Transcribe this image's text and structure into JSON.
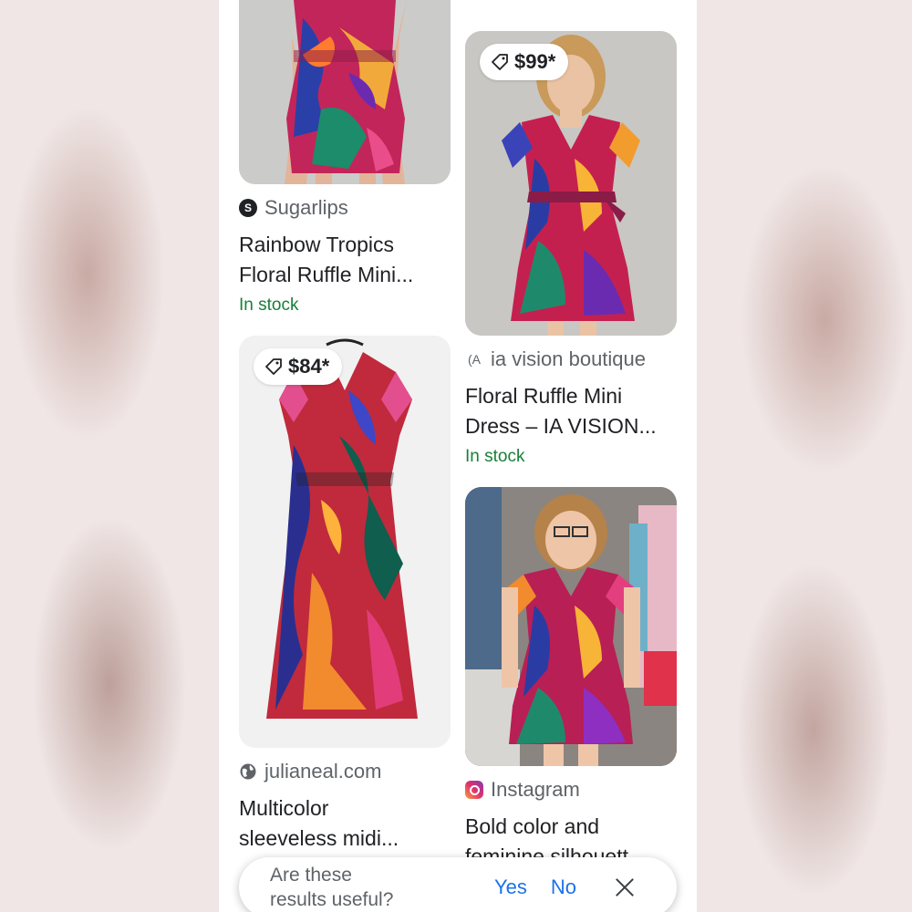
{
  "results": {
    "left": [
      {
        "source": "Sugarlips",
        "source_icon": "sugarlips-logo-icon",
        "title_lines": [
          "Rainbow Tropics",
          "Floral Ruffle Mini..."
        ],
        "stock": "In stock"
      },
      {
        "price": "$84*",
        "source": "julianeal.com",
        "source_icon": "globe-icon",
        "title_lines": [
          "Multicolor",
          "sleeveless midi..."
        ]
      }
    ],
    "right": [
      {
        "price": "$99*",
        "source": "ia vision boutique",
        "source_icon": "ia-vision-logo-icon",
        "title_lines": [
          "Floral Ruffle Mini",
          "Dress – IA VISION..."
        ],
        "stock": "In stock"
      },
      {
        "source": "Instagram",
        "source_icon": "instagram-icon",
        "title_lines": [
          "Bold color and",
          "feminine silhouett..."
        ]
      }
    ]
  },
  "feedback": {
    "question_lines": [
      "Are these",
      "results useful?"
    ],
    "yes_label": "Yes",
    "no_label": "No"
  },
  "colors": {
    "stock": "#188038",
    "link": "#1a73e8",
    "text": "#202124",
    "muted": "#5f6368"
  }
}
